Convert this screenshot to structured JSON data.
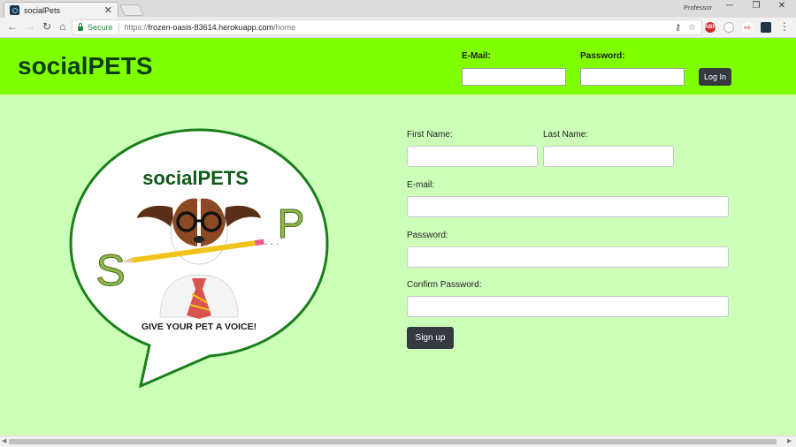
{
  "browser": {
    "tab_title": "socialPets",
    "tab_close": "✕",
    "profile_name": "Professor",
    "secure_label": "Secure",
    "url_scheme": "https://",
    "url_host": "frozen-oasis-83614.herokuapp.com",
    "url_path": "/home",
    "nav_icons": [
      "arrow-left-icon",
      "arrow-right-icon",
      "reload-icon",
      "home-icon"
    ],
    "window_controls": {
      "minimize": "─",
      "restore": "❐",
      "close": "✕"
    },
    "extensions": [
      {
        "name": "adblock-icon",
        "label": "ABP",
        "color": "#d62828"
      },
      {
        "name": "ghostery-icon",
        "label": "",
        "color": "#b7b7b7"
      },
      {
        "name": "readium-icon",
        "label": "",
        "color": "#f26b6b"
      },
      {
        "name": "react-devtools-icon",
        "label": "",
        "color": "#20354a"
      }
    ]
  },
  "header": {
    "brand": "socialPETS",
    "email_label": "E-Mail:",
    "email_value": "",
    "password_label": "Password:",
    "password_value": "",
    "login_label": "Log In",
    "background": "#80ff00"
  },
  "logo": {
    "title": "socialPETS",
    "letter_s": "S",
    "letter_p": "P",
    "dots": ". . .",
    "tagline": "GIVE YOUR PET A VOICE!"
  },
  "signup": {
    "first_name_label": "First Name:",
    "last_name_label": "Last Name:",
    "email_label": "E-mail:",
    "password_label": "Password:",
    "confirm_label": "Confirm Password:",
    "submit_label": "Sign up"
  },
  "colors": {
    "page_background": "#ccffb8",
    "brand_text": "#0b3d12",
    "button_dark": "#343a40",
    "bubble_border": "#1a7f1a"
  }
}
